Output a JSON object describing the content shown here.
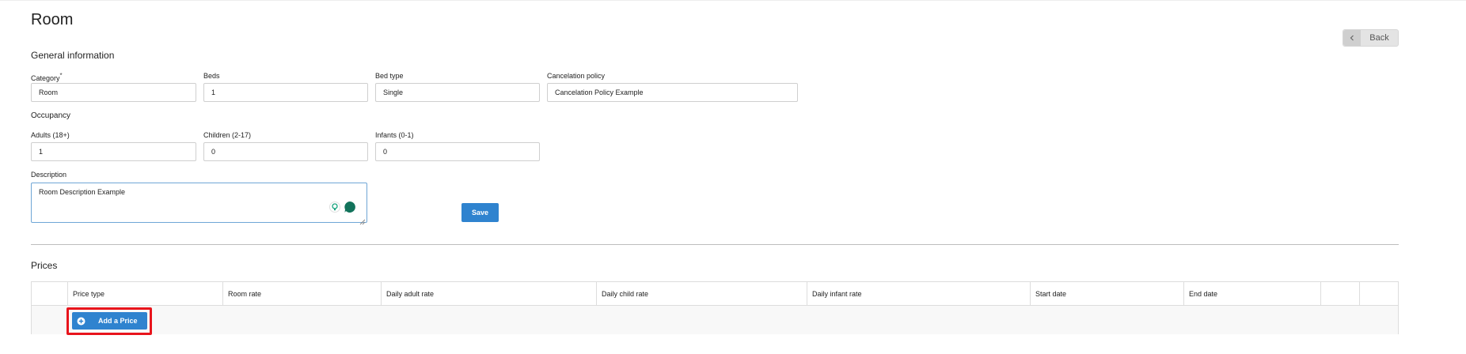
{
  "page": {
    "title": "Room",
    "back_label": "Back"
  },
  "general": {
    "heading": "General information",
    "category": {
      "label": "Category",
      "required_mark": "*",
      "value": "Room"
    },
    "beds": {
      "label": "Beds",
      "value": "1"
    },
    "bed_type": {
      "label": "Bed type",
      "value": "Single"
    },
    "cancelation_policy": {
      "label": "Cancelation policy",
      "value": "Cancelation Policy Example"
    }
  },
  "occupancy": {
    "heading": "Occupancy",
    "adults": {
      "label": "Adults (18+)",
      "value": "1"
    },
    "children": {
      "label": "Children (2-17)",
      "value": "0"
    },
    "infants": {
      "label": "Infants (0-1)",
      "value": "0"
    }
  },
  "description": {
    "label": "Description",
    "value": "Room Description Example",
    "icons": [
      "lightbulb-icon",
      "speech-bubble-icon"
    ]
  },
  "save_label": "Save",
  "prices": {
    "heading": "Prices",
    "columns": [
      "Price type",
      "Room rate",
      "Daily adult rate",
      "Daily child rate",
      "Daily infant rate",
      "Start date",
      "End date",
      "",
      ""
    ],
    "add_price_label": "Add a Price"
  },
  "colors": {
    "primary": "#2f83cf",
    "highlight": "#e8141c",
    "border": "#cfcfcf"
  }
}
